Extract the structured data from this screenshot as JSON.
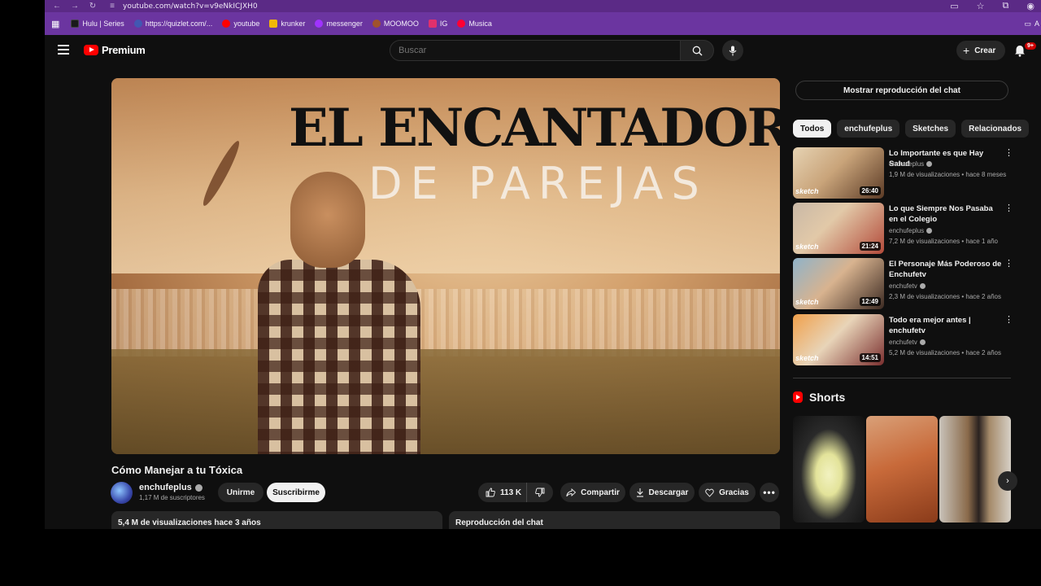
{
  "browser": {
    "url": "youtube.com/watch?v=v9eNkICJXH0",
    "bookmarks": [
      {
        "label": "Hulu | Series",
        "color": "#1a1a1a"
      },
      {
        "label": "https://quizlet.com/...",
        "color": "#4257b2"
      },
      {
        "label": "youtube",
        "color": "#ff0000"
      },
      {
        "label": "krunker",
        "color": "#f2b705"
      },
      {
        "label": "messenger",
        "color": "#a033ff"
      },
      {
        "label": "MOOMOO",
        "color": "#a0522d"
      },
      {
        "label": "IG",
        "color": "#e1306c"
      },
      {
        "label": "Musica",
        "color": "#ff0033"
      }
    ],
    "bookmarks_right": "A"
  },
  "header": {
    "logo_text": "Premium",
    "search_placeholder": "Buscar",
    "create_label": "Crear",
    "notif_badge": "9+"
  },
  "video": {
    "overlay_line1": "EL ENCANTADOR",
    "overlay_line2": "DE PAREJAS",
    "title": "Cómo Manejar a tu Tóxica",
    "channel": "enchufeplus",
    "subscribers": "1,17 M de suscriptores",
    "join_label": "Unirme",
    "subscribe_label": "Suscribirme",
    "likes": "113 K",
    "share_label": "Compartir",
    "download_label": "Descargar",
    "thanks_label": "Gracias",
    "views_age": "5,4 M de visualizaciones  hace 3 años",
    "chat_replay": "Reproducción del chat"
  },
  "sidebar": {
    "show_chat": "Mostrar reproducción del chat",
    "chips": [
      "Todos",
      "enchufeplus",
      "Sketches",
      "Relacionados"
    ],
    "recommendations": [
      {
        "title": "Lo Importante es que Hay Salud",
        "channel": "enchufeplus",
        "meta": "1,9 M de visualizaciones • hace 8 meses",
        "duration": "26:40",
        "badge": "sketch"
      },
      {
        "title": "Lo que Siempre Nos Pasaba en el Colegio",
        "channel": "enchufeplus",
        "meta": "7,2 M de visualizaciones • hace 1 año",
        "duration": "21:24",
        "badge": "sketch"
      },
      {
        "title": "El Personaje Más Poderoso de Enchufetv",
        "channel": "enchufetv",
        "meta": "2,3 M de visualizaciones • hace 2 años",
        "duration": "12:49",
        "badge": "sketch"
      },
      {
        "title": "Todo era mejor antes | enchufetv",
        "channel": "enchufetv",
        "meta": "5,2 M de visualizaciones • hace 2 años",
        "duration": "14:51",
        "badge": "sketch"
      }
    ],
    "shorts_label": "Shorts"
  }
}
